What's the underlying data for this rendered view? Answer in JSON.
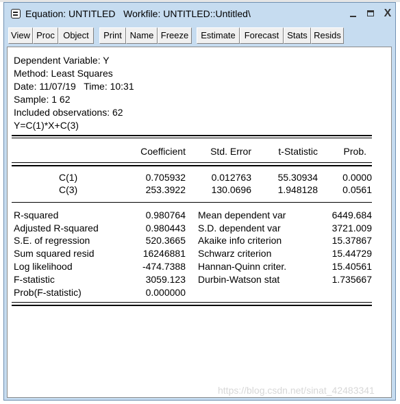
{
  "window": {
    "title": "Equation: UNTITLED   Workfile: UNTITLED::Untitled\\",
    "controls": {
      "minimize": "_",
      "maximize": "□",
      "close": "X"
    }
  },
  "toolbar": {
    "buttons": [
      "View",
      "Proc",
      "Object",
      "Print",
      "Name",
      "Freeze",
      "Estimate",
      "Forecast",
      "Stats",
      "Resids"
    ]
  },
  "header": {
    "dependent_variable": "Dependent Variable: Y",
    "method": "Method: Least Squares",
    "date": "Date: 11/07/19   Time: 10:31",
    "sample": "Sample: 1 62",
    "observations": "Included observations: 62",
    "equation": "Y=C(1)*X+C(3)"
  },
  "coef_table": {
    "headers": [
      "Coefficient",
      "Std. Error",
      "t-Statistic",
      "Prob."
    ],
    "rows": [
      {
        "var": "C(1)",
        "coef": "0.705932",
        "se": "0.012763",
        "t": "55.30934",
        "p": "0.0000"
      },
      {
        "var": "C(3)",
        "coef": "253.3922",
        "se": "130.0696",
        "t": "1.948128",
        "p": "0.0561"
      }
    ]
  },
  "stats": {
    "left": [
      {
        "label": "R-squared",
        "value": "0.980764"
      },
      {
        "label": "Adjusted R-squared",
        "value": "0.980443"
      },
      {
        "label": "S.E. of regression",
        "value": "520.3665"
      },
      {
        "label": "Sum squared resid",
        "value": "16246881"
      },
      {
        "label": "Log likelihood",
        "value": "-474.7388"
      },
      {
        "label": "F-statistic",
        "value": "3059.123"
      },
      {
        "label": "Prob(F-statistic)",
        "value": "0.000000"
      }
    ],
    "right": [
      {
        "label": "Mean dependent var",
        "value": "6449.684"
      },
      {
        "label": "S.D. dependent var",
        "value": "3721.009"
      },
      {
        "label": "Akaike info criterion",
        "value": "15.37867"
      },
      {
        "label": "Schwarz criterion",
        "value": "15.44729"
      },
      {
        "label": "Hannan-Quinn criter.",
        "value": "15.40561"
      },
      {
        "label": "Durbin-Watson stat",
        "value": "1.735667"
      }
    ]
  },
  "watermark": "https://blog.csdn.net/sinat_42483341"
}
